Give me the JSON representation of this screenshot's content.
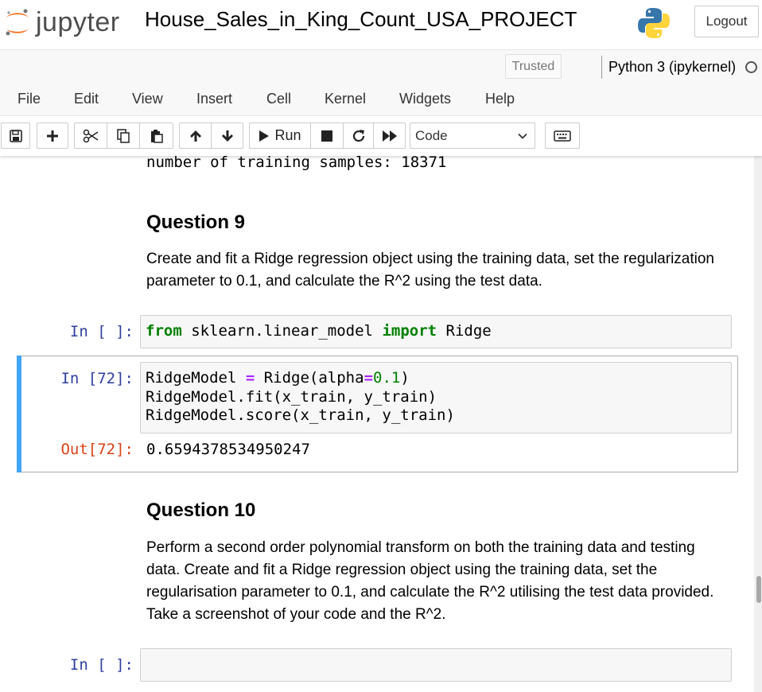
{
  "header": {
    "logo_text": "jupyter",
    "notebook_title": "House_Sales_in_King_Count_USA_PROJECT",
    "logout_label": "Logout"
  },
  "status": {
    "trusted_label": "Trusted",
    "kernel_name": "Python 3 (ipykernel)"
  },
  "menu": {
    "items": [
      "File",
      "Edit",
      "View",
      "Insert",
      "Cell",
      "Kernel",
      "Widgets",
      "Help"
    ]
  },
  "toolbar": {
    "run_label": "Run",
    "cell_type": "Code",
    "icons": [
      "save-icon",
      "plus-icon",
      "scissors-icon",
      "copy-icon",
      "paste-icon",
      "arrow-up-icon",
      "arrow-down-icon",
      "play-icon",
      "stop-icon",
      "restart-icon",
      "fast-forward-icon",
      "keyboard-icon"
    ]
  },
  "notebook": {
    "prev_output": "number of training samples: 18371",
    "q9": {
      "title": "Question 9",
      "text": "Create and fit a Ridge regression object using the training data, set the regularization parameter to 0.1, and calculate the R^2 using the test data."
    },
    "cell1": {
      "prompt": "In [ ]:",
      "kw_from": "from",
      "module": " sklearn.linear_model ",
      "kw_import": "import",
      "name": " Ridge"
    },
    "cell2": {
      "prompt": "In [72]:",
      "line1_a": "RidgeModel ",
      "line1_op": "=",
      "line1_b": " Ridge(alpha",
      "line1_op2": "=",
      "line1_num": "0.1",
      "line1_c": ")",
      "line2": "RidgeModel.fit(x_train, y_train)",
      "line3": "RidgeModel.score(x_train, y_train)",
      "out_prompt": "Out[72]:",
      "out_value": "0.6594378534950247"
    },
    "q10": {
      "title": "Question 10",
      "text": "Perform a second order polynomial transform on both the training data and testing data. Create and fit a Ridge regression object using the training data, set the regularisation parameter to 0.1, and calculate the R^2 utilising the test data provided. Take a screenshot of your code and the R^2."
    },
    "cell3": {
      "prompt": "In [ ]:"
    }
  },
  "colors": {
    "prompt_in": "#303f9f",
    "prompt_out": "#d84315",
    "selected_bar": "#42a5f5",
    "keyword": "#008000",
    "operator": "#aa22ff"
  }
}
